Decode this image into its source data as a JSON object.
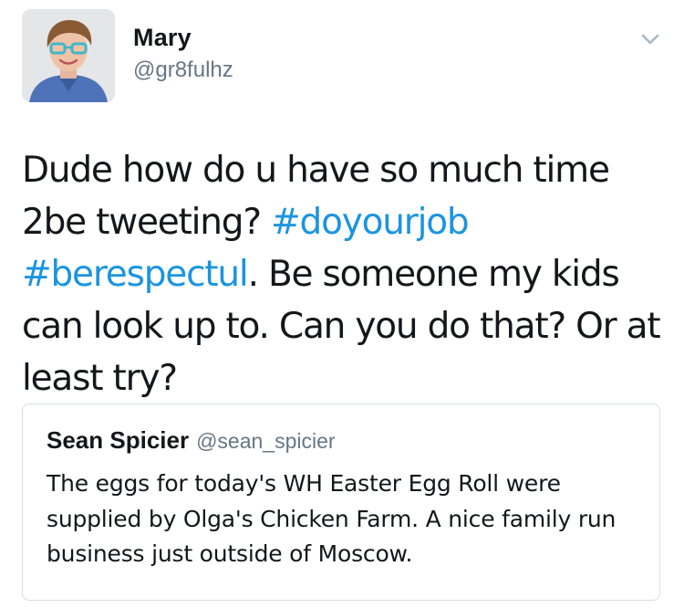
{
  "tweet": {
    "author_name": "Mary",
    "author_handle": "@gr8fulhz",
    "text_before": "Dude how do u have so much time 2be tweeting? ",
    "hashtag_1": "#doyourjob",
    "text_between": " ",
    "hashtag_2": "#berespectul",
    "text_after": ". Be someone my kids can look up to. Can you do that? Or at least try?",
    "menu_icon": "chevron-down-icon",
    "link_color": "#1b95e0"
  },
  "quoted_tweet": {
    "author_name": "Sean Spicier",
    "author_handle": "@sean_spicier",
    "text": "The eggs for today's WH Easter Egg Roll were supplied by Olga's Chicken Farm. A nice family run business just outside of Moscow."
  }
}
